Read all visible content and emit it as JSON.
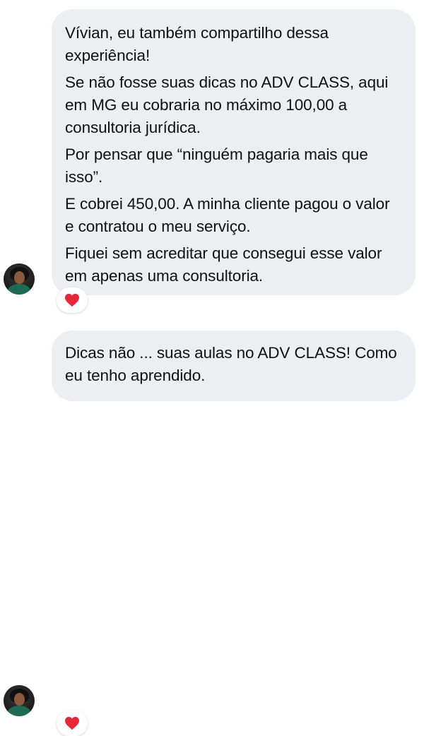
{
  "messages": [
    {
      "paragraphs": [
        "Vívian, eu também compartilho dessa experiência!",
        "Se não fosse suas dicas no ADV CLASS, aqui em MG eu cobraria no máximo 100,00 a consultoria jurídica.",
        "Por pensar que “ninguém pagaria mais que isso”.",
        "E cobrei 450,00. A minha cliente pagou o valor e contratou o meu serviço.",
        "Fiquei sem acreditar que consegui esse valor em apenas uma consultoria."
      ],
      "reaction": "heart-icon",
      "avatar": "avatar"
    },
    {
      "paragraphs": [
        "Dicas não ... suas aulas no ADV CLASS! Como eu tenho aprendido."
      ],
      "reaction": "heart-icon",
      "avatar": "avatar"
    }
  ],
  "colors": {
    "bubble": "#eceef1",
    "text": "#111111",
    "heart": "#e8263a",
    "background": "#ffffff"
  }
}
